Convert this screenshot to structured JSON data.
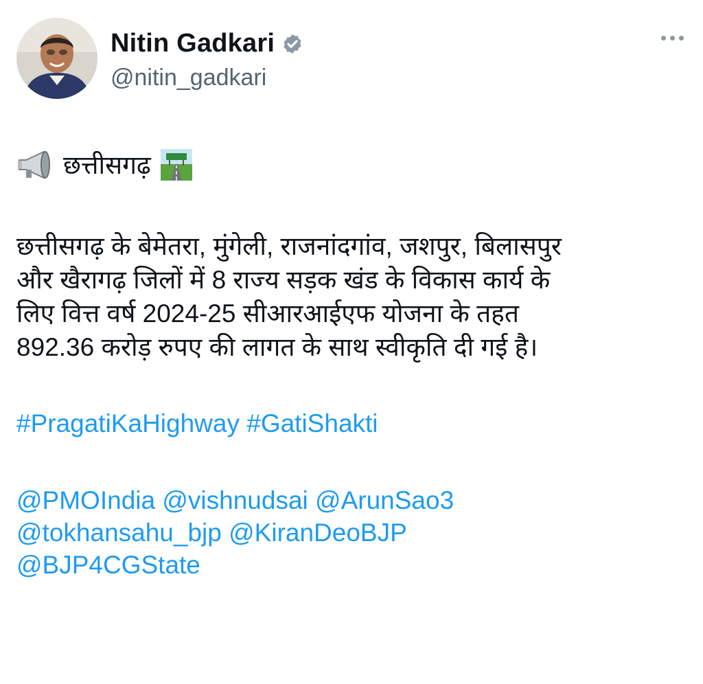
{
  "author": {
    "display_name": "Nitin Gadkari",
    "handle": "@nitin_gadkari"
  },
  "icons": {
    "verified": "verified-badge-icon",
    "more": "more-options-icon",
    "megaphone": "megaphone-emoji",
    "road": "motorway-emoji"
  },
  "tweet": {
    "heading": "छत्तीसगढ़",
    "paragraph_lines": [
      "छत्तीसगढ़ के बेमेतरा, मुंगेली, राजनांदगांव, जशपुर, बिलासपुर",
      "और खैरागढ़ जिलों में 8 राज्य सड़क खंड के विकास कार्य के",
      "लिए वित्त वर्ष 2024-25 सीआरआईएफ योजना के तहत",
      "892.36 करोड़ रुपए की लागत के साथ स्वीकृति दी गई है।"
    ],
    "hashtags": [
      "#PragatiKaHighway",
      "#GatiShakti"
    ],
    "mention_lines": [
      [
        "@PMOIndia",
        "@vishnudsai",
        "@ArunSao3"
      ],
      [
        "@tokhansahu_bjp",
        "@KiranDeoBJP"
      ],
      [
        "@BJP4CGState"
      ]
    ]
  },
  "colors": {
    "link": "#1d9bf0",
    "handle": "#536471",
    "verified_fill": "#8b98a5"
  }
}
